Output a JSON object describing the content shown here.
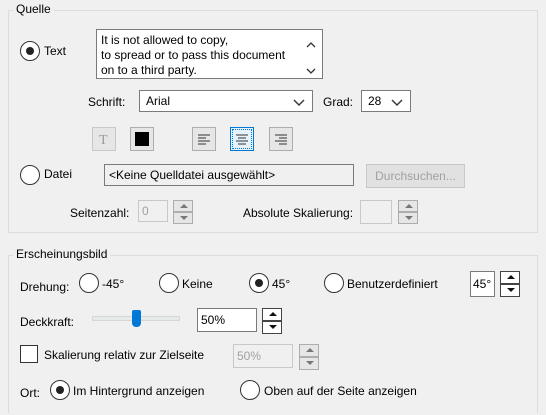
{
  "source": {
    "group_title": "Quelle",
    "text_radio_label": "Text",
    "text_content": "It is not allowed to copy,\nto spread or to pass this document\non to a third party.",
    "font_label": "Schrift:",
    "font_value": "Arial",
    "size_label": "Grad:",
    "size_value": "28",
    "file_radio_label": "Datei",
    "file_value": "<Keine Quelldatei ausgewählt>",
    "browse_label": "Durchsuchen...",
    "page_number_label": "Seitenzahl:",
    "page_number_value": "0",
    "absolute_scale_label": "Absolute Skalierung:",
    "absolute_scale_value": "",
    "text_color": "#000000"
  },
  "appearance": {
    "group_title": "Erscheinungsbild",
    "rotation_label": "Drehung:",
    "rotation_options": [
      "-45°",
      "Keine",
      "45°",
      "Benutzerdefiniert"
    ],
    "rotation_selected": "45°",
    "custom_rotation_value": "45°",
    "opacity_label": "Deckkraft:",
    "opacity_value": "50%",
    "opacity_level": 0.5,
    "scale_relative_label": "Skalierung relativ zur Zielseite",
    "scale_relative_checked": false,
    "scale_relative_value": "50%",
    "location_label": "Ort:",
    "location_options": [
      "Im Hintergrund anzeigen",
      "Oben auf der Seite anzeigen"
    ],
    "location_selected": "Im Hintergrund anzeigen"
  },
  "colors": {
    "accent": "#0078d7"
  }
}
